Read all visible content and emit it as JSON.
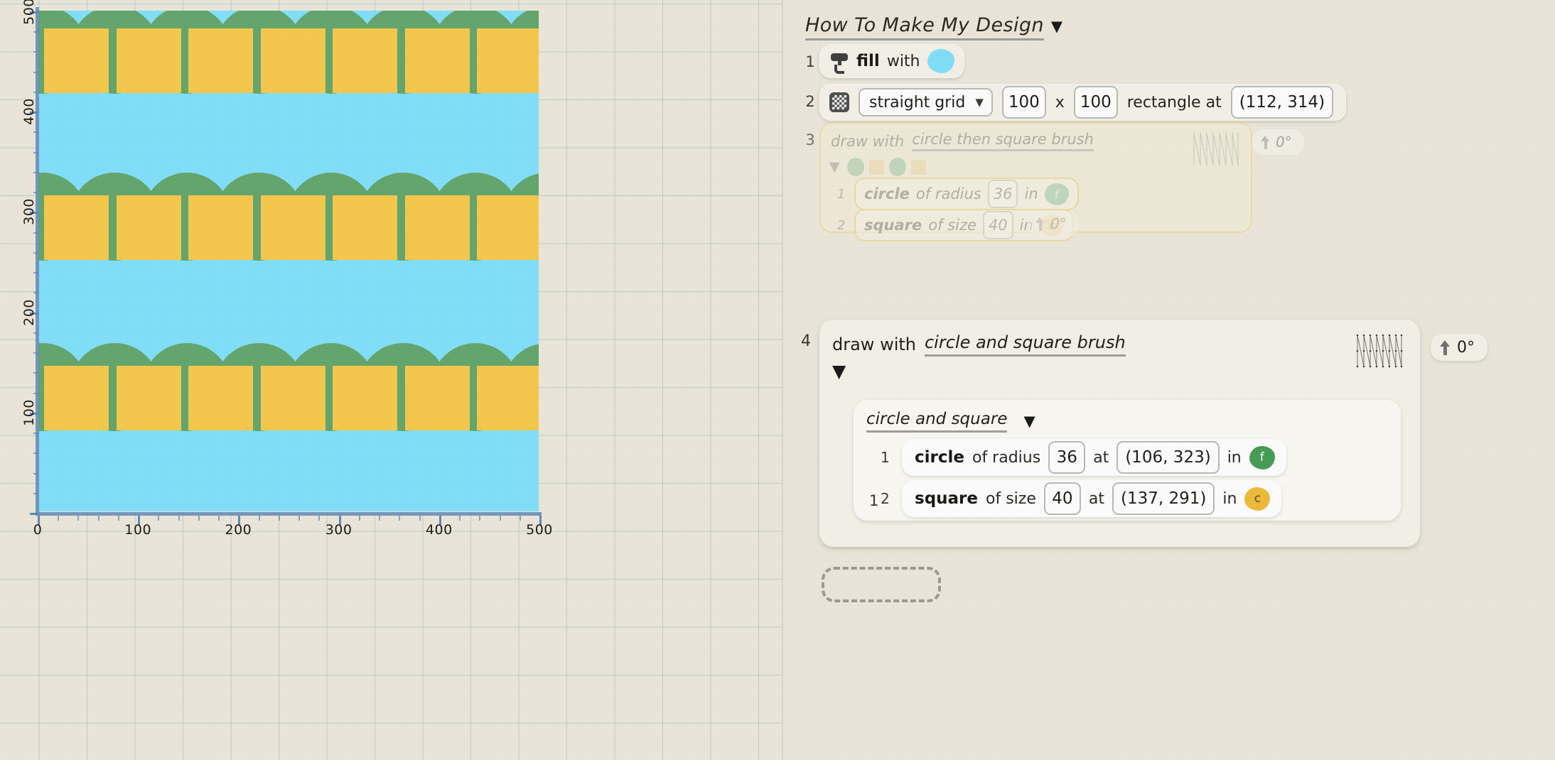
{
  "program": {
    "title": "How To Make My Design",
    "title_caret": "▼",
    "steps": [
      {
        "number": "1",
        "icon": "paint-roller-icon",
        "verb": "fill",
        "preposition": "with",
        "color_swatch": "#7ddffb"
      },
      {
        "number": "2",
        "icon": "checker-grid-icon",
        "layout": "straight grid",
        "chevron": "⌄",
        "width": "100",
        "times": "x",
        "height": "100",
        "shape_label": "rectangle at",
        "position": "(112, 314)"
      },
      {
        "number": "3",
        "state": "ghost",
        "verb": "draw with",
        "brush_name": "circle then square brush",
        "caret": "▼",
        "path_icon": "zigzag-path-icon",
        "rotation": "0°",
        "swatches": [
          "circle",
          "square",
          "circle",
          "square"
        ],
        "children": [
          {
            "number": "1",
            "shape": "circle",
            "param_label": "of radius",
            "param_value": "36",
            "in_label": "in",
            "palette_letter": "f",
            "palette_color": "#a5cfa9"
          },
          {
            "number": "2",
            "shape": "square",
            "param_label": "of size",
            "param_value": "40",
            "in_label": "in",
            "palette_letter": "c",
            "palette_color": "#f0d391",
            "rotation": "0°"
          }
        ]
      },
      {
        "number": "4",
        "state": "active",
        "verb": "draw with",
        "brush_name": "circle and square brush",
        "caret": "▼",
        "path_icon": "zigzag-path-icon",
        "rotation": "0°",
        "group": {
          "number": "1",
          "name": "circle and square",
          "caret": "▼",
          "children": [
            {
              "number": "1",
              "shape": "circle",
              "param_label": "of radius",
              "param_value": "36",
              "at_label": "at",
              "position": "(106, 323)",
              "in_label": "in",
              "palette_letter": "f",
              "palette_color": "#3f9a4f"
            },
            {
              "number": "2",
              "shape": "square",
              "param_label": "of size",
              "param_value": "40",
              "at_label": "at",
              "position": "(137, 291)",
              "in_label": "in",
              "palette_letter": "c",
              "palette_color": "#efb933",
              "rotation": "0°"
            }
          ]
        }
      }
    ],
    "dropzone": ""
  },
  "canvas": {
    "background_color": "#7ee0fb",
    "circle_color": "#5ea468",
    "square_color": "#f7c846",
    "x_ticks": [
      "0",
      "100",
      "200",
      "300",
      "400",
      "500"
    ],
    "y_ticks": [
      "100",
      "200",
      "300",
      "400",
      "500"
    ],
    "axis_color": "#5b86b5"
  }
}
